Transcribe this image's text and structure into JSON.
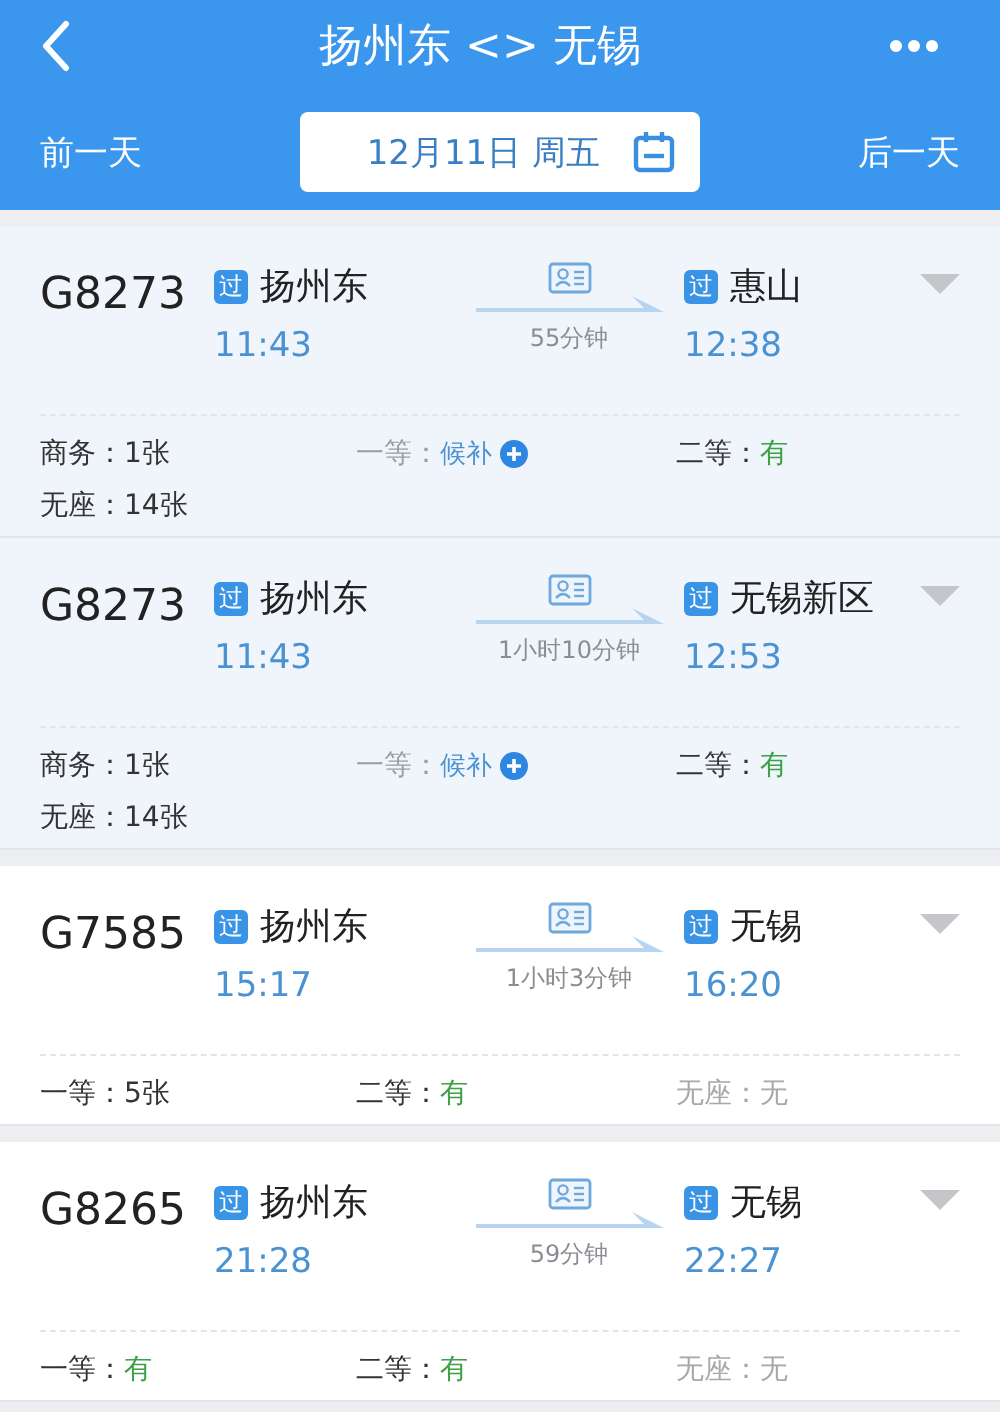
{
  "header": {
    "title": "扬州东 <> 无锡",
    "prev_day": "前一天",
    "date": "12月11日 周五",
    "next_day": "后一天"
  },
  "trains": [
    {
      "number": "G8273",
      "highlighted": true,
      "from": {
        "badge": "过",
        "station": "扬州东",
        "time": "11:43"
      },
      "duration": "55分钟",
      "to": {
        "badge": "过",
        "station": "惠山",
        "time": "12:38"
      },
      "seats": [
        {
          "label": "商务：",
          "value": "1张",
          "kind": "count"
        },
        {
          "label": "一等：",
          "value": "候补",
          "kind": "waitlist"
        },
        {
          "label": "二等：",
          "value": "有",
          "kind": "available"
        },
        {
          "label": "无座：",
          "value": "14张",
          "kind": "count"
        }
      ]
    },
    {
      "number": "G8273",
      "highlighted": true,
      "from": {
        "badge": "过",
        "station": "扬州东",
        "time": "11:43"
      },
      "duration": "1小时10分钟",
      "to": {
        "badge": "过",
        "station": "无锡新区",
        "time": "12:53"
      },
      "seats": [
        {
          "label": "商务：",
          "value": "1张",
          "kind": "count"
        },
        {
          "label": "一等：",
          "value": "候补",
          "kind": "waitlist"
        },
        {
          "label": "二等：",
          "value": "有",
          "kind": "available"
        },
        {
          "label": "无座：",
          "value": "14张",
          "kind": "count"
        }
      ]
    },
    {
      "number": "G7585",
      "highlighted": false,
      "from": {
        "badge": "过",
        "station": "扬州东",
        "time": "15:17"
      },
      "duration": "1小时3分钟",
      "to": {
        "badge": "过",
        "station": "无锡",
        "time": "16:20"
      },
      "seats": [
        {
          "label": "一等：",
          "value": "5张",
          "kind": "count"
        },
        {
          "label": "二等：",
          "value": "有",
          "kind": "available"
        },
        {
          "label": "无座：",
          "value": "无",
          "kind": "none"
        }
      ]
    },
    {
      "number": "G8265",
      "highlighted": false,
      "from": {
        "badge": "过",
        "station": "扬州东",
        "time": "21:28"
      },
      "duration": "59分钟",
      "to": {
        "badge": "过",
        "station": "无锡",
        "time": "22:27"
      },
      "seats": [
        {
          "label": "一等：",
          "value": "有",
          "kind": "available"
        },
        {
          "label": "二等：",
          "value": "有",
          "kind": "available"
        },
        {
          "label": "无座：",
          "value": "无",
          "kind": "none"
        }
      ]
    }
  ]
}
